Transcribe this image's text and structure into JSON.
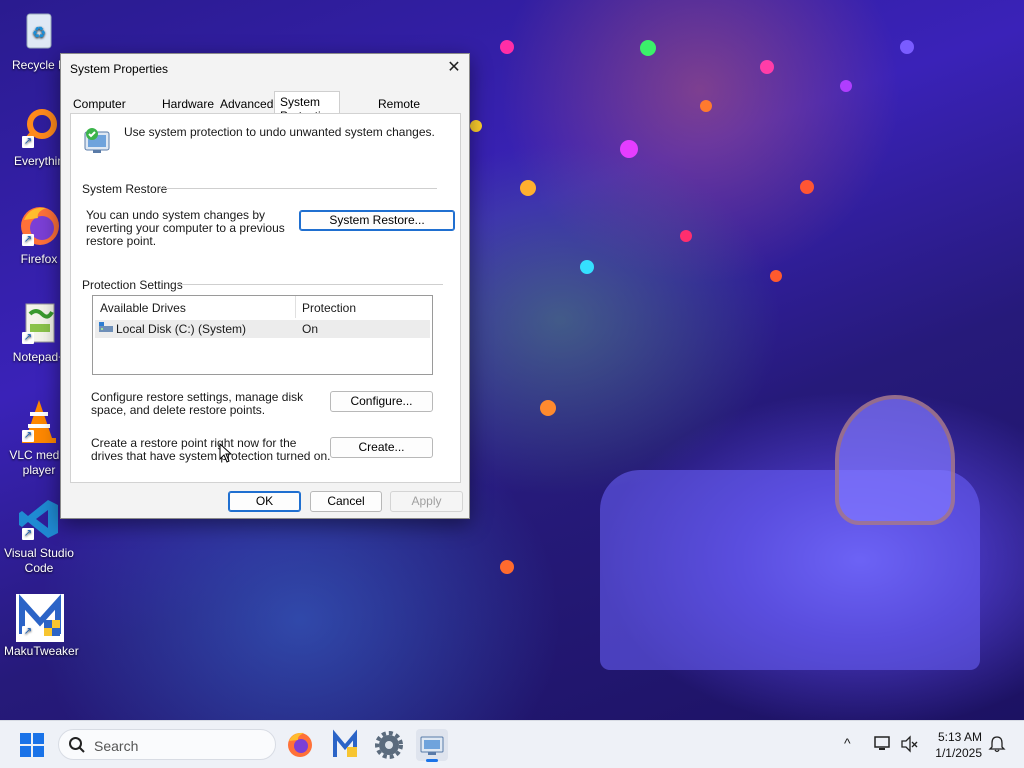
{
  "desktop": {
    "icons": [
      {
        "label": "Recycle B"
      },
      {
        "label": "Everythin"
      },
      {
        "label": "Firefox"
      },
      {
        "label": "Notepad+"
      },
      {
        "label": "VLC media player"
      },
      {
        "label": "Visual Studio Code"
      },
      {
        "label": "MakuTweaker"
      }
    ]
  },
  "dialog": {
    "title": "System Properties",
    "close_glyph": "✕",
    "tabs": [
      {
        "label": "Computer Name"
      },
      {
        "label": "Hardware"
      },
      {
        "label": "Advanced"
      },
      {
        "label": "System Protection",
        "active": true
      },
      {
        "label": "Remote"
      }
    ],
    "intro_text": "Use system protection to undo unwanted system changes.",
    "system_restore": {
      "group_title": "System Restore",
      "description": "You can undo system changes by reverting your computer to a previous restore point.",
      "button_label": "System Restore..."
    },
    "protection_settings": {
      "group_title": "Protection Settings",
      "columns": [
        "Available Drives",
        "Protection"
      ],
      "rows": [
        {
          "drive": "Local Disk (C:) (System)",
          "protection": "On"
        }
      ],
      "configure_text": "Configure restore settings, manage disk space, and delete restore points.",
      "configure_button": "Configure...",
      "create_text": "Create a restore point right now for the drives that have system protection turned on.",
      "create_button": "Create..."
    },
    "footer": {
      "ok": "OK",
      "cancel": "Cancel",
      "apply": "Apply"
    }
  },
  "taskbar": {
    "search_placeholder": "Search",
    "time": "5:13 AM",
    "date": "1/1/2025",
    "chevron_glyph": "^"
  }
}
